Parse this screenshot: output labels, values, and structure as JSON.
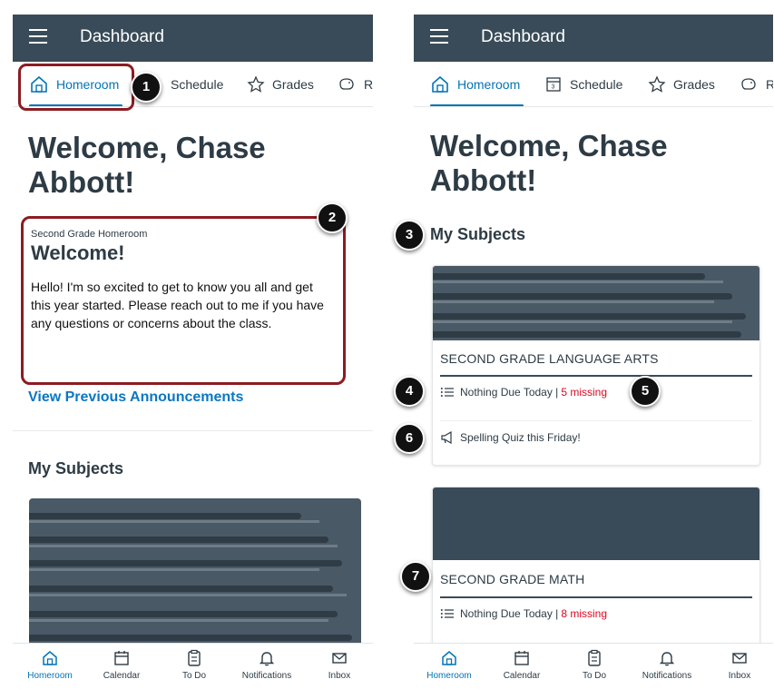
{
  "app": {
    "title": "Dashboard"
  },
  "tabs": [
    {
      "label": "Homeroom"
    },
    {
      "label": "Schedule"
    },
    {
      "label": "Grades"
    },
    {
      "label": "R"
    },
    {
      "label": "Re"
    }
  ],
  "welcome": {
    "line1": "Welcome, Chase",
    "line2": "Abbott!"
  },
  "announcement": {
    "course": "Second Grade Homeroom",
    "title": "Welcome!",
    "body": "Hello! I'm so excited to get to know you all and get this year started. Please reach out to me if you have any questions or concerns about the class."
  },
  "view_previous_link": "View Previous Announcements",
  "my_subjects_label": "My Subjects",
  "subjects": [
    {
      "name": "SECOND GRADE LANGUAGE ARTS",
      "due_text": "Nothing Due Today |",
      "missing_text": "5 missing",
      "announcement": "Spelling Quiz this Friday!"
    },
    {
      "name": "SECOND GRADE MATH",
      "due_text": "Nothing Due Today |",
      "missing_text": "8 missing"
    }
  ],
  "bottom_nav": [
    {
      "label": "Homeroom",
      "icon": "homeroom-icon"
    },
    {
      "label": "Calendar",
      "icon": "calendar-icon"
    },
    {
      "label": "To Do",
      "icon": "todo-icon"
    },
    {
      "label": "Notifications",
      "icon": "bell-icon"
    },
    {
      "label": "Inbox",
      "icon": "inbox-icon"
    }
  ],
  "callouts": [
    "1",
    "2",
    "3",
    "4",
    "5",
    "6",
    "7"
  ],
  "colors": {
    "topbar": "#394b58",
    "accent": "#0374b5",
    "missing": "#e0061f",
    "highlight": "#8b1c21"
  }
}
